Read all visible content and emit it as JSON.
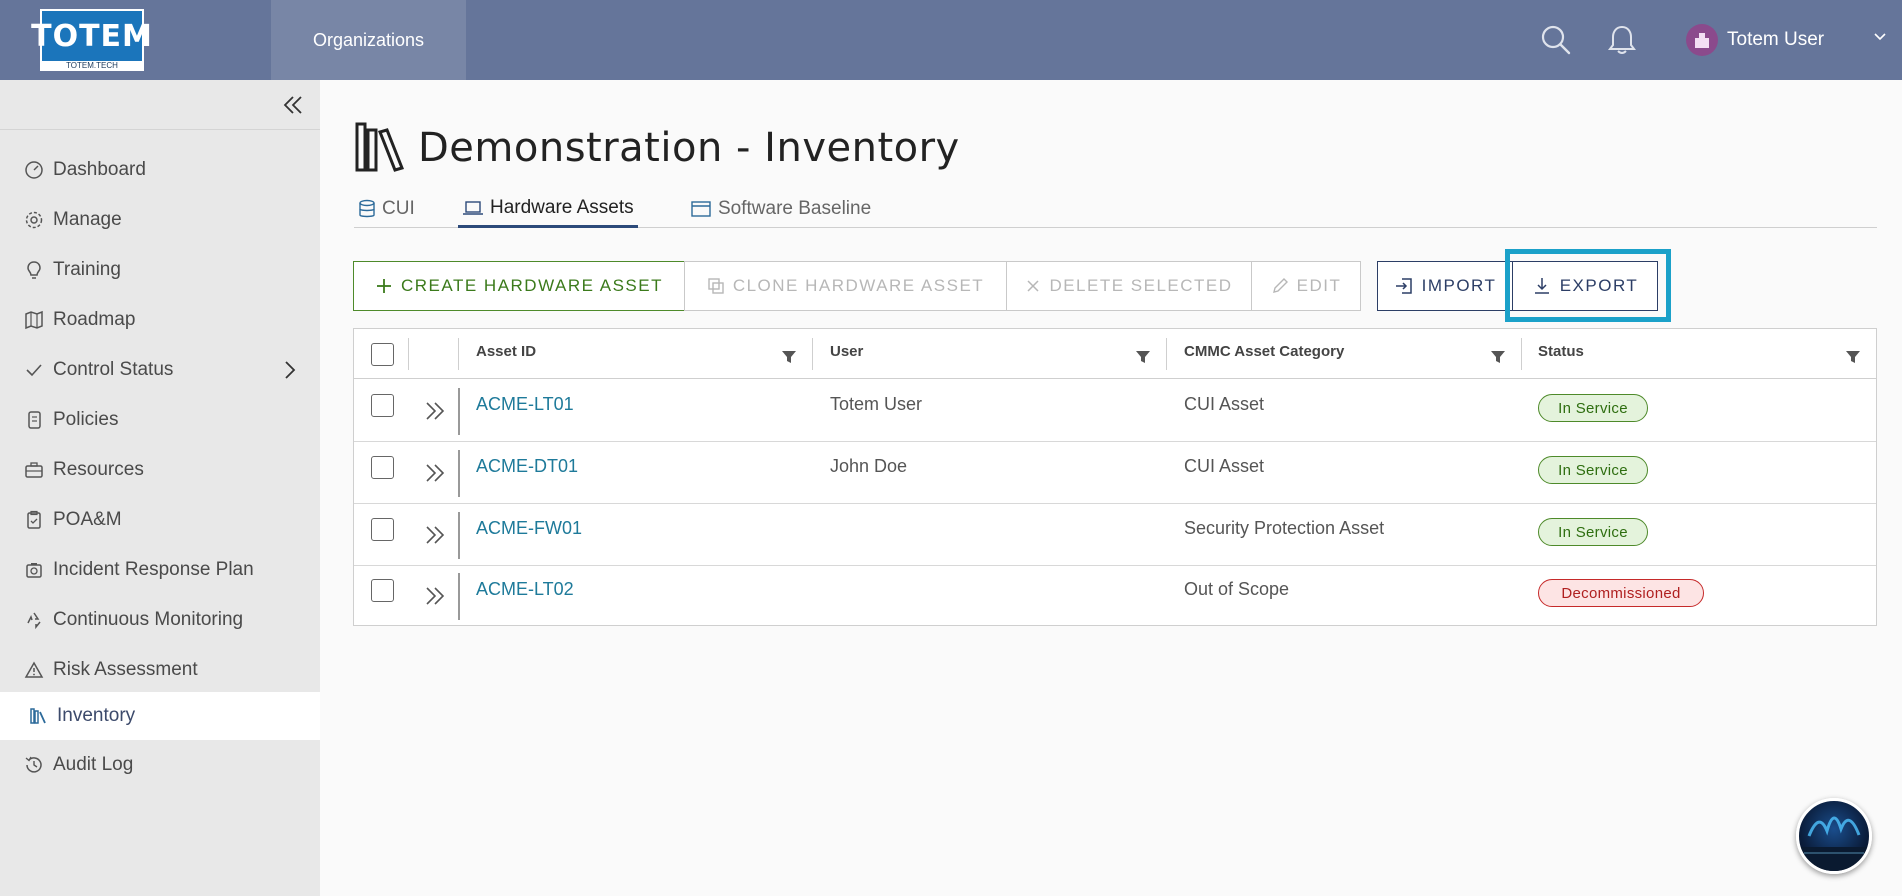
{
  "header": {
    "logo_text": "TOTEM",
    "logo_sub": "TOTEM.TECH",
    "nav_item": "Organizations",
    "user_name": "Totem User"
  },
  "sidebar": {
    "items": [
      {
        "label": "Dashboard",
        "icon": "dashboard-icon"
      },
      {
        "label": "Manage",
        "icon": "gear-icon"
      },
      {
        "label": "Training",
        "icon": "lightbulb-icon"
      },
      {
        "label": "Roadmap",
        "icon": "map-icon"
      },
      {
        "label": "Control Status",
        "icon": "check-icon"
      },
      {
        "label": "Policies",
        "icon": "scroll-icon"
      },
      {
        "label": "Resources",
        "icon": "toolbox-icon"
      },
      {
        "label": "POA&M",
        "icon": "clipboard-icon"
      },
      {
        "label": "Incident Response Plan",
        "icon": "camera-icon"
      },
      {
        "label": "Continuous Monitoring",
        "icon": "recycle-icon"
      },
      {
        "label": "Risk Assessment",
        "icon": "warning-icon"
      },
      {
        "label": "Inventory",
        "icon": "books-icon"
      },
      {
        "label": "Audit Log",
        "icon": "history-icon"
      }
    ],
    "active": "Inventory"
  },
  "page": {
    "title": "Demonstration - Inventory",
    "tabs": [
      {
        "label": "CUI"
      },
      {
        "label": "Hardware Assets"
      },
      {
        "label": "Software Baseline"
      }
    ],
    "active_tab": "Hardware Assets"
  },
  "toolbar": {
    "create": "CREATE HARDWARE ASSET",
    "clone": "CLONE HARDWARE ASSET",
    "delete": "DELETE SELECTED",
    "edit": "EDIT",
    "import": "IMPORT",
    "export": "EXPORT"
  },
  "table": {
    "columns": [
      "Asset ID",
      "User",
      "CMMC Asset Category",
      "Status"
    ],
    "rows": [
      {
        "asset_id": "ACME-LT01",
        "user": "Totem User",
        "category": "CUI Asset",
        "status": "In Service"
      },
      {
        "asset_id": "ACME-DT01",
        "user": "John Doe",
        "category": "CUI Asset",
        "status": "In Service"
      },
      {
        "asset_id": "ACME-FW01",
        "user": "",
        "category": "Security Protection Asset",
        "status": "In Service"
      },
      {
        "asset_id": "ACME-LT02",
        "user": "",
        "category": "Out of Scope",
        "status": "Decommissioned"
      }
    ]
  },
  "colors": {
    "header_bg": "#65759a",
    "sidebar_bg": "#e8e8e8",
    "accent_green": "#3b7a1b",
    "accent_navy": "#2c3e66",
    "highlight": "#1ba1c9",
    "status_ok": "#4e8a2a",
    "status_bad": "#c62a2a"
  }
}
